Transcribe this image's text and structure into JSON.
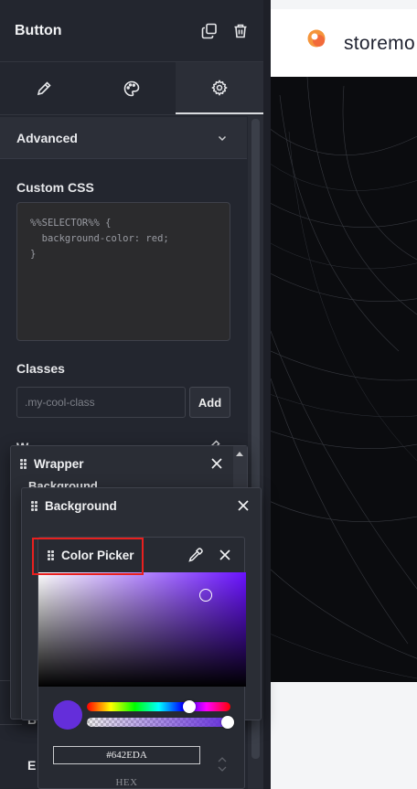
{
  "panel": {
    "title": "Button",
    "header_icons": [
      "copy-icon",
      "trash-icon"
    ],
    "tabs": [
      {
        "name": "content",
        "icon": "pencil-icon",
        "active": false
      },
      {
        "name": "style",
        "icon": "palette-icon",
        "active": false
      },
      {
        "name": "advanced",
        "icon": "gear-icon",
        "active": true
      }
    ],
    "section": {
      "title": "Advanced",
      "icon": "chevron-down-icon"
    },
    "custom_css": {
      "label": "Custom CSS",
      "code": "%%SELECTOR%% {\n  background-color: red;\n}"
    },
    "classes": {
      "label": "Classes",
      "placeholder": ".my-cool-class",
      "add_label": "Add"
    },
    "peeks": {
      "w": "W",
      "b": "B",
      "e": "E"
    }
  },
  "preview": {
    "logo_text": "storemo",
    "logo_colors": [
      "#f5953b",
      "#f26a3a"
    ]
  },
  "wrapper_panel": {
    "title": "Wrapper",
    "sub_label": "Background"
  },
  "background_panel": {
    "title": "Background"
  },
  "color_picker": {
    "title": "Color Picker",
    "hex_value": "#642EDA",
    "hex_label": "HEX",
    "hue_color": "#6a12ff",
    "selected_color": "#642EDA",
    "highlight_color": "#e8201f"
  },
  "colors": {
    "panel_bg": "#23262f",
    "accent": "#642EDA"
  }
}
